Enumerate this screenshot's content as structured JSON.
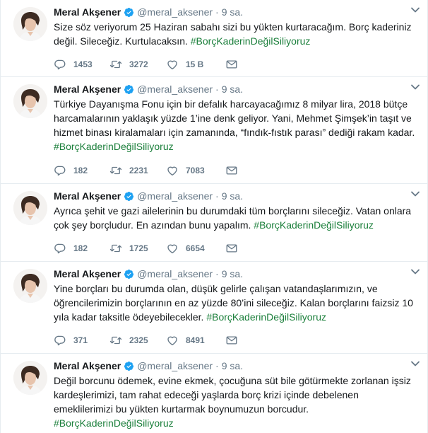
{
  "author": {
    "name": "Meral Akşener",
    "handle": "@meral_aksener"
  },
  "colors": {
    "hashtag": "#1b7f3b",
    "verified": "#1da1f2",
    "meta": "#657786"
  },
  "tweets": [
    {
      "time": "9 sa.",
      "text": "Size söz veriyorum 25 Haziran sabahı sizi bu yükten kurtaracağım. Borç kaderiniz değil. Sileceğiz. Kurtulacaksın.",
      "hashtag": "#BorçKaderinDeğilSiliyoruz",
      "replies": "1453",
      "retweets": "3272",
      "likes": "15 B"
    },
    {
      "time": "9 sa.",
      "text": "Türkiye Dayanışma Fonu için bir defalık harcayacağımız 8 milyar lira, 2018 bütçe harcamalarının yaklaşık yüzde 1’ine denk geliyor. Yani, Mehmet Şimşek’in taşıt ve hizmet binası kiralamaları için zamanında, “fındık-fıstık parası” dediği rakam kadar.",
      "hashtag": "#BorçKaderinDeğilSiliyoruz",
      "replies": "182",
      "retweets": "2231",
      "likes": "7083"
    },
    {
      "time": "9 sa.",
      "text": "Ayrıca şehit ve gazi ailelerinin bu durumdaki tüm borçlarını sileceğiz. Vatan onlara çok şey borçludur. En azından bunu yapalım.",
      "hashtag": "#BorçKaderinDeğilSiliyoruz",
      "replies": "182",
      "retweets": "1725",
      "likes": "6654"
    },
    {
      "time": "9 sa.",
      "text": "Yine borçları bu durumda olan, düşük gelirle çalışan vatandaşlarımızın, ve öğrencilerimizin borçlarının en az yüzde 80’ini sileceğiz. Kalan borçlarını faizsiz 10 yıla kadar taksitle ödeyebilecekler.",
      "hashtag": "#BorçKaderinDeğilSiliyoruz",
      "replies": "371",
      "retweets": "2325",
      "likes": "8491"
    },
    {
      "time": "9 sa.",
      "text": "Değil borcunu ödemek, evine ekmek, çocuğuna süt bile götürmekte zorlanan işsiz kardeşlerimizi, tam rahat edeceği yaşlarda borç krizi içinde debelenen emeklilerimizi bu yükten kurtarmak boynumuzun borcudur.",
      "hashtag": "#BorçKaderinDeğilSiliyoruz"
    }
  ]
}
